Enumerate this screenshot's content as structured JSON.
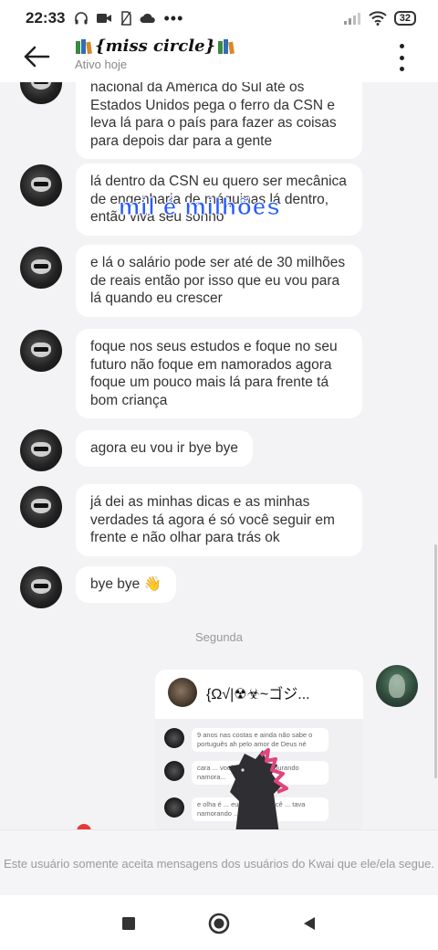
{
  "status_bar": {
    "time": "22:33",
    "battery": "32"
  },
  "header": {
    "title": "{miss circle}",
    "subtitle": "Ativo hoje"
  },
  "messages": [
    {
      "text": "nacional da América do Sul até os Estados Unidos pega o ferro da CSN e leva lá para o país para fazer as coisas para depois dar para a gente"
    },
    {
      "text": "lá dentro da CSN eu quero ser mecânica de engenharia de máquinas lá dentro, então viva seu sonho"
    },
    {
      "text": "e lá o salário pode ser até de 30 milhões de reais então por isso que eu vou para lá quando eu crescer"
    },
    {
      "text": "foque nos seus estudos e foque no seu futuro não foque em namorados agora foque um pouco mais lá para frente tá bom criança"
    },
    {
      "text": "agora eu vou ir bye bye"
    },
    {
      "text": "já dei as minhas dicas e as minhas verdades tá agora é só você seguir em frente e não olhar para trás ok"
    },
    {
      "text": "bye bye 👋"
    }
  ],
  "overlay_text": "mil é milhões",
  "time_separator": "Segunda",
  "shared_card": {
    "name": "{Ω√|☢☣~ゴジ...",
    "mini_messages": [
      "9 anos nas costas e ainda não sabe o português ah pelo amor de Deus né",
      "cara ... você tem nove ... durando namora...",
      "e olha é ... eu falei que você ... tava namorando ... estava"
    ]
  },
  "footer_notice": "Este usuário somente aceita mensagens dos usuários do Kwai que ele/ela segue."
}
